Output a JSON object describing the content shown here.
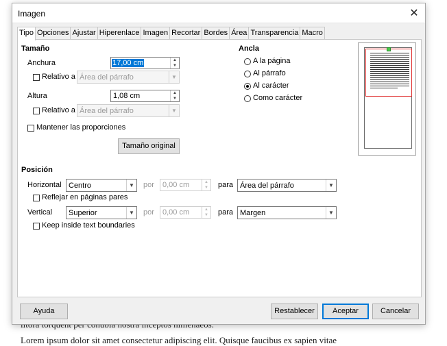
{
  "background": {
    "line1": "litora torquent per conubia nostra inceptos himenaeos.",
    "line2": "Lorem ipsum dolor sit amet consectetur adipiscing elit. Quisque faucibus ex sapien vitae"
  },
  "dialog": {
    "title": "Imagen",
    "close_icon": "close-icon",
    "tabs": [
      "Tipo",
      "Opciones",
      "Ajustar",
      "Hiperenlace",
      "Imagen",
      "Recortar",
      "Bordes",
      "Área",
      "Transparencia",
      "Macro"
    ],
    "active_tab": "Tipo"
  },
  "tamano": {
    "heading": "Tamaño",
    "anchura_label": "Anchura",
    "anchura_value": "17,00 cm",
    "relativo1_label": "Relativo a",
    "relativo1_value": "Área del párrafo",
    "altura_label": "Altura",
    "altura_value": "1,08 cm",
    "relativo2_label": "Relativo a",
    "relativo2_value": "Área del párrafo",
    "mantener_label": "Mantener las proporciones",
    "original_button": "Tamaño original"
  },
  "ancla": {
    "heading": "Ancla",
    "options": [
      "A la página",
      "Al párrafo",
      "Al carácter",
      "Como carácter"
    ],
    "selected": "Al carácter"
  },
  "posicion": {
    "heading": "Posición",
    "horizontal_label": "Horizontal",
    "horizontal_value": "Centro",
    "por1_label": "por",
    "por1_value": "0,00 cm",
    "para1_label": "para",
    "para1_value": "Área del párrafo",
    "reflejar_label": "Reflejar en páginas pares",
    "vertical_label": "Vertical",
    "vertical_value": "Superior",
    "por2_label": "por",
    "por2_value": "0,00 cm",
    "para2_label": "para",
    "para2_value": "Margen",
    "keep_label": "Keep inside text boundaries"
  },
  "buttons": {
    "help": "Ayuda",
    "reset": "Restablecer",
    "ok": "Aceptar",
    "cancel": "Cancelar"
  },
  "colors": {
    "accent": "#0078d7",
    "preview_frame": "#e03030",
    "preview_handle": "#46c846"
  }
}
